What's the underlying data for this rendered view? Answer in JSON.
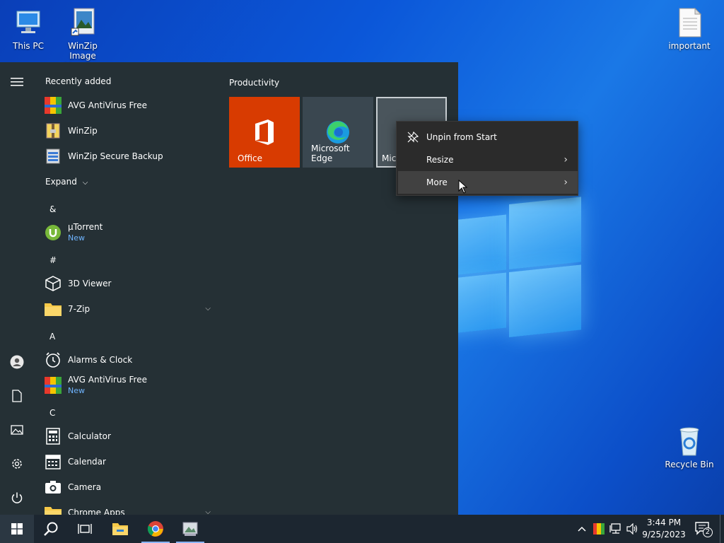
{
  "desktop": {
    "icons": [
      {
        "label": "This PC"
      },
      {
        "label": "WinZip Image Manager"
      },
      {
        "label": "important"
      },
      {
        "label": "Recycle Bin"
      }
    ]
  },
  "start_menu": {
    "recently_added_title": "Recently added",
    "recent": [
      {
        "label": "AVG AntiVirus Free"
      },
      {
        "label": "WinZip"
      },
      {
        "label": "WinZip Secure Backup"
      }
    ],
    "expand_label": "Expand",
    "sections": {
      "amp": "&",
      "hash": "#",
      "a": "A",
      "c": "C"
    },
    "apps": {
      "utorrent": {
        "label": "µTorrent",
        "sub": "New"
      },
      "viewer3d": {
        "label": "3D Viewer"
      },
      "zip7": {
        "label": "7-Zip"
      },
      "alarms": {
        "label": "Alarms & Clock"
      },
      "avg": {
        "label": "AVG AntiVirus Free",
        "sub": "New"
      },
      "calculator": {
        "label": "Calculator"
      },
      "calendar": {
        "label": "Calendar"
      },
      "camera": {
        "label": "Camera"
      },
      "chrome_apps": {
        "label": "Chrome Apps"
      }
    },
    "group_title": "Productivity",
    "tiles": [
      {
        "label": "Office",
        "color": "#d83b01"
      },
      {
        "label": "Microsoft Edge",
        "color": "#3a4750"
      },
      {
        "label": "Mic",
        "color": "#4a555c"
      }
    ]
  },
  "context_menu": {
    "items": [
      {
        "label": "Unpin from Start"
      },
      {
        "label": "Resize"
      },
      {
        "label": "More"
      }
    ]
  },
  "taskbar": {
    "time": "3:44 PM",
    "date": "9/25/2023",
    "notifications": "2"
  }
}
